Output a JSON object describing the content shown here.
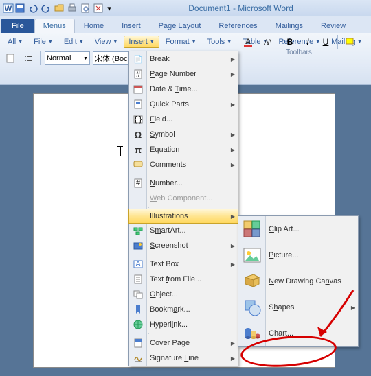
{
  "title": "Document1 - Microsoft Word",
  "qat": [
    "save",
    "undo",
    "redo",
    "open",
    "print",
    "preview",
    "close"
  ],
  "tabs": {
    "file": "File",
    "menus": "Menus",
    "home": "Home",
    "insert": "Insert",
    "page": "Page Layout",
    "refs": "References",
    "mail": "Mailings",
    "review": "Review"
  },
  "menubar": {
    "all": "All",
    "file": "File",
    "edit": "Edit",
    "view": "View",
    "insert": "Insert",
    "format": "Format",
    "tools": "Tools",
    "table": "Table",
    "reference": "Reference",
    "mailing": "Mailing"
  },
  "toolrow": {
    "style": "Normal",
    "font": "宋体 (Boc"
  },
  "toolbars_label": "Toolbars",
  "insert_menu": {
    "break": "Break",
    "pagenum": "Page Number",
    "datetime": "Date & Time...",
    "quickparts": "Quick Parts",
    "field": "Field...",
    "symbol": "Symbol",
    "equation": "Equation",
    "comments": "Comments",
    "number": "Number...",
    "webcomp": "Web Component...",
    "illustrations": "Illustrations",
    "smartart": "SmartArt...",
    "screenshot": "Screenshot",
    "textbox": "Text Box",
    "textfile": "Text from File...",
    "object": "Object...",
    "bookmark": "Bookmark...",
    "hyperlink": "Hyperlink...",
    "coverpage": "Cover Page",
    "sigline": "Signature Line"
  },
  "illus_menu": {
    "clipart": "Clip Art...",
    "picture": "Picture...",
    "canvas": "New Drawing Canvas",
    "shapes": "Shapes",
    "chart": "Chart..."
  }
}
